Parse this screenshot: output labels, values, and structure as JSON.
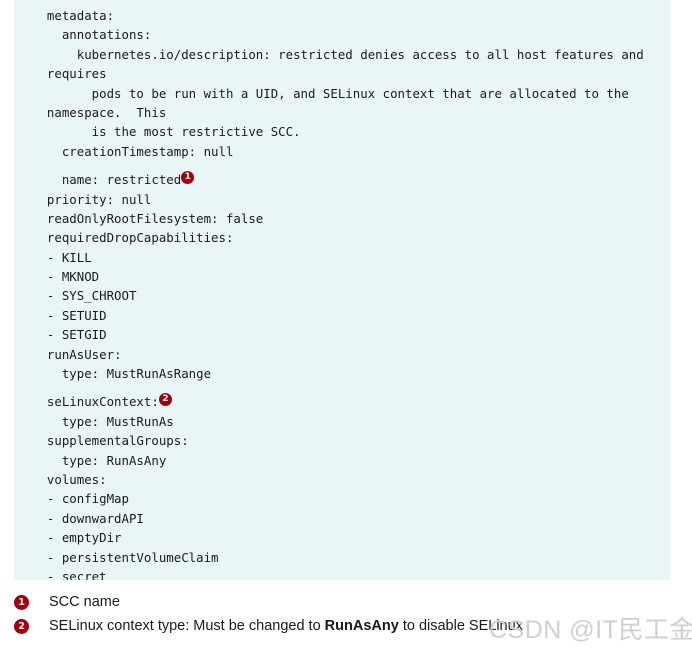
{
  "colors": {
    "code_background": "#eaf5f7",
    "callout_badge": "#a4010e",
    "page_background": "#ffffff",
    "code_text": "#1b1b1b",
    "watermark": "#cfcfcf"
  },
  "code_block": {
    "language": "yaml",
    "lines": [
      {
        "text": "  metadata:",
        "gap_before": false
      },
      {
        "text": "    annotations:",
        "gap_before": false
      },
      {
        "text": "      kubernetes.io/description: restricted denies access to all host features and",
        "gap_before": false
      },
      {
        "text": "  requires",
        "gap_before": false
      },
      {
        "text": "        pods to be run with a UID, and SELinux context that are allocated to the",
        "gap_before": false
      },
      {
        "text": "  namespace.  This",
        "gap_before": false
      },
      {
        "text": "        is the most restrictive SCC.",
        "gap_before": false
      },
      {
        "text": "    creationTimestamp: null",
        "gap_before": false
      },
      {
        "text": "    name: restricted",
        "gap_before": true,
        "badge": "1"
      },
      {
        "text": "  priority: null",
        "gap_before": false
      },
      {
        "text": "  readOnlyRootFilesystem: false",
        "gap_before": false
      },
      {
        "text": "  requiredDropCapabilities:",
        "gap_before": false
      },
      {
        "text": "  - KILL",
        "gap_before": false
      },
      {
        "text": "  - MKNOD",
        "gap_before": false
      },
      {
        "text": "  - SYS_CHROOT",
        "gap_before": false
      },
      {
        "text": "  - SETUID",
        "gap_before": false
      },
      {
        "text": "  - SETGID",
        "gap_before": false
      },
      {
        "text": "  runAsUser:",
        "gap_before": false
      },
      {
        "text": "    type: MustRunAsRange",
        "gap_before": false
      },
      {
        "text": "  seLinuxContext:",
        "gap_before": true,
        "badge": "2"
      },
      {
        "text": "    type: MustRunAs",
        "gap_before": false
      },
      {
        "text": "  supplementalGroups:",
        "gap_before": false
      },
      {
        "text": "    type: RunAsAny",
        "gap_before": false
      },
      {
        "text": "  volumes:",
        "gap_before": false
      },
      {
        "text": "  - configMap",
        "gap_before": false
      },
      {
        "text": "  - downwardAPI",
        "gap_before": false
      },
      {
        "text": "  - emptyDir",
        "gap_before": false
      },
      {
        "text": "  - persistentVolumeClaim",
        "gap_before": false
      },
      {
        "text": "  - secret",
        "gap_before": false
      }
    ]
  },
  "legend": {
    "items": [
      {
        "number": "1",
        "parts": [
          {
            "text": "SCC name",
            "bold": false
          }
        ]
      },
      {
        "number": "2",
        "parts": [
          {
            "text": "SELinux context type: Must be changed to ",
            "bold": false
          },
          {
            "text": "RunAsAny",
            "bold": true
          },
          {
            "text": " to disable SELinux",
            "bold": false
          }
        ]
      }
    ]
  },
  "watermark": {
    "text": "CSDN @IT民工金鱼哥"
  }
}
